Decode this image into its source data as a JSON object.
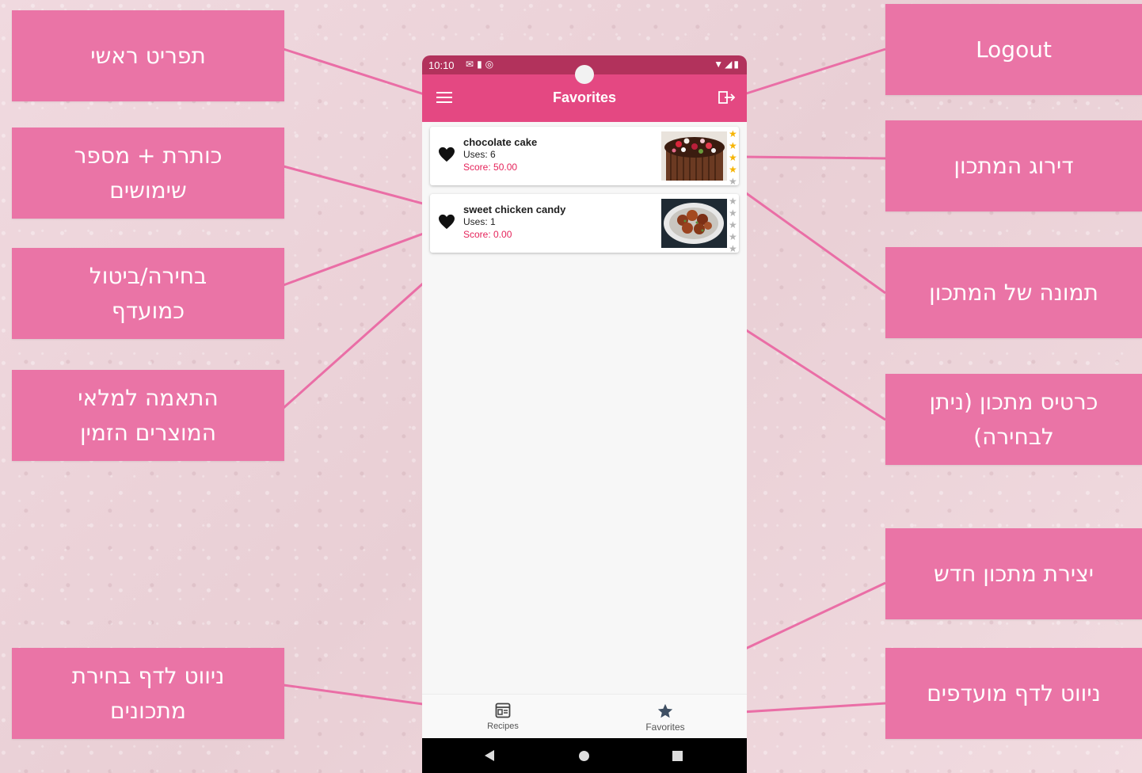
{
  "annotations": {
    "main_menu": "תפריט ראשי",
    "title_uses": [
      "כותרת + מספר",
      "שימושים"
    ],
    "toggle_favorite": [
      "בחירה/ביטול",
      "כמועדף"
    ],
    "pantry_match": [
      "התאמה למלאי",
      "המוצרים הזמין"
    ],
    "nav_recipes": [
      "ניווט לדף בחירת",
      "מתכונים"
    ],
    "logout": "Logout",
    "rating": "דירוג המתכון",
    "recipe_image": "תמונה של המתכון",
    "recipe_card": [
      "כרטיס מתכון (ניתן",
      "לבחירה)"
    ],
    "new_recipe": "יצירת מתכון חדש",
    "nav_favorites": "ניווט לדף מועדפים"
  },
  "status_bar": {
    "time": "10:10",
    "left_icons": [
      "mail-icon",
      "sd-card-icon",
      "sync-icon"
    ],
    "right_icons": [
      "wifi-icon",
      "signal-icon",
      "battery-icon"
    ]
  },
  "app_bar": {
    "title": "Favorites",
    "menu_icon": "menu-icon",
    "logout_icon": "logout-icon",
    "color": "#e44882"
  },
  "recipes": [
    {
      "title": "chocolate cake",
      "uses": "Uses: 6",
      "score": "Score: 50.00",
      "favorite": true,
      "stars": 4,
      "max_stars": 5,
      "image": "chocolate-cake-photo"
    },
    {
      "title": "sweet chicken candy",
      "uses": "Uses: 1",
      "score": "Score: 0.00",
      "favorite": true,
      "stars": 0,
      "max_stars": 5,
      "image": "chicken-dish-photo"
    }
  ],
  "fab": {
    "label": "+",
    "color": "#3cae49"
  },
  "bottom_nav": {
    "recipes_label": "Recipes",
    "favorites_label": "Favorites"
  },
  "colors": {
    "callout": "#ea74a6",
    "score": "#e5245b",
    "star_on": "#f6b400",
    "star_off": "#b3b3b3"
  }
}
